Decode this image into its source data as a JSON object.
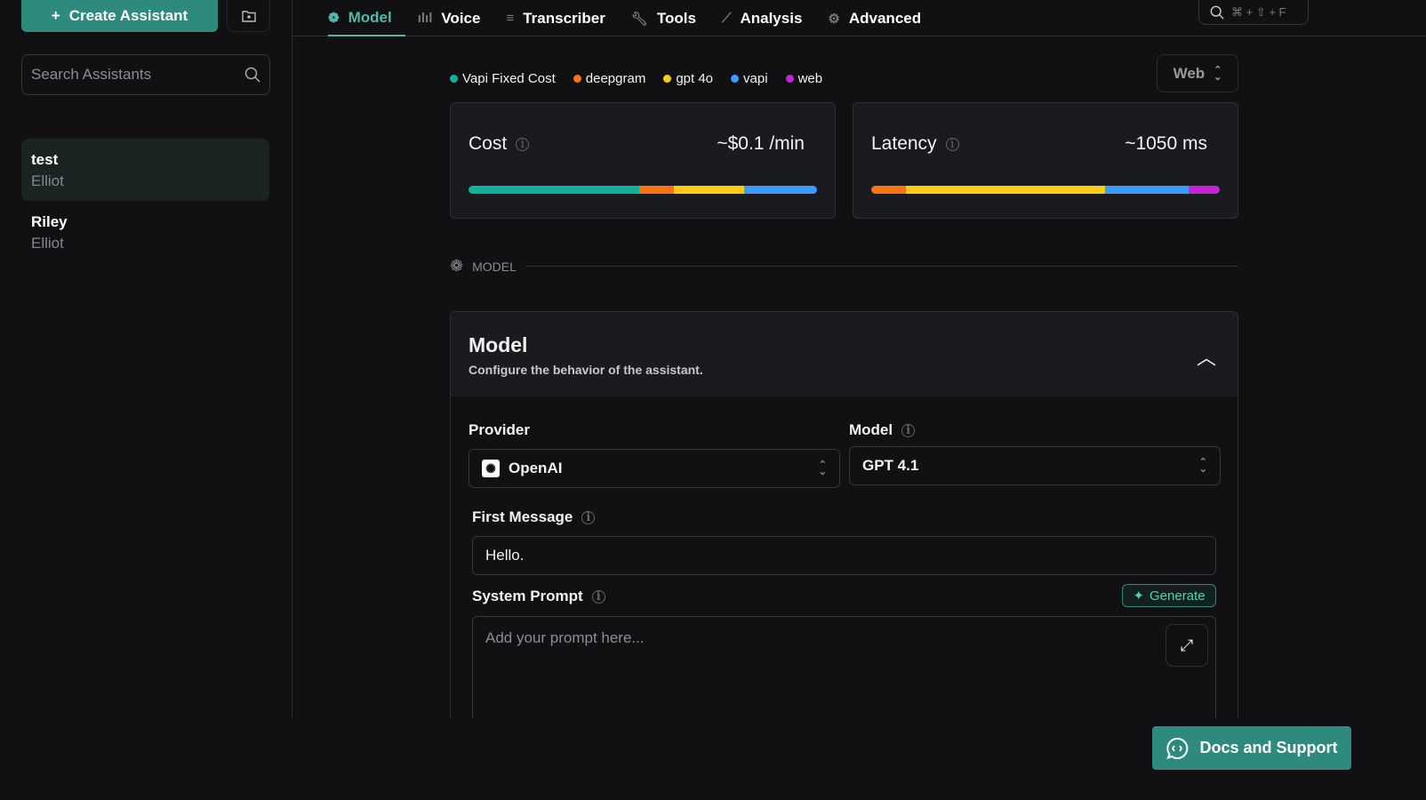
{
  "sidebar": {
    "create_label": "Create Assistant",
    "search_placeholder": "Search Assistants",
    "assistants": [
      {
        "name": "test",
        "subtitle": "Elliot",
        "selected": true
      },
      {
        "name": "Riley",
        "subtitle": "Elliot",
        "selected": false
      }
    ]
  },
  "tabs": [
    {
      "label": "Model",
      "icon": "brain-icon"
    },
    {
      "label": "Voice",
      "icon": "waveform-icon"
    },
    {
      "label": "Transcriber",
      "icon": "lines-icon"
    },
    {
      "label": "Tools",
      "icon": "wrench-icon"
    },
    {
      "label": "Analysis",
      "icon": "chart-icon"
    },
    {
      "label": "Advanced",
      "icon": "gear-icon"
    }
  ],
  "shortcut": "⌘ + ⇧ + F",
  "legend": [
    {
      "label": "Vapi Fixed Cost",
      "color": "#10b29b"
    },
    {
      "label": "deepgram",
      "color": "#f97316"
    },
    {
      "label": "gpt 4o",
      "color": "#facc15"
    },
    {
      "label": "vapi",
      "color": "#3b9bff"
    },
    {
      "label": "web",
      "color": "#c026d3"
    }
  ],
  "platform_select": "Web",
  "cost": {
    "label": "Cost",
    "value": "~$0.1 /min",
    "segments": [
      {
        "color": "#10b29b",
        "pct": 49
      },
      {
        "color": "#f97316",
        "pct": 10
      },
      {
        "color": "#facc15",
        "pct": 20
      },
      {
        "color": "#3b9bff",
        "pct": 21
      }
    ]
  },
  "latency": {
    "label": "Latency",
    "value": "~1050 ms",
    "segments": [
      {
        "color": "#f97316",
        "pct": 10
      },
      {
        "color": "#facc15",
        "pct": 57
      },
      {
        "color": "#3b9bff",
        "pct": 24
      },
      {
        "color": "#c026d3",
        "pct": 9
      }
    ]
  },
  "section_label": "MODEL",
  "model_panel": {
    "title": "Model",
    "subtitle": "Configure the behavior of the assistant.",
    "provider_label": "Provider",
    "provider_value": "OpenAI",
    "model_label": "Model",
    "model_value": "GPT 4.1",
    "first_message_label": "First Message",
    "first_message_value": "Hello.",
    "system_prompt_label": "System Prompt",
    "system_prompt_placeholder": "Add your prompt here...",
    "generate_label": "Generate"
  },
  "docs_label": "Docs and Support"
}
